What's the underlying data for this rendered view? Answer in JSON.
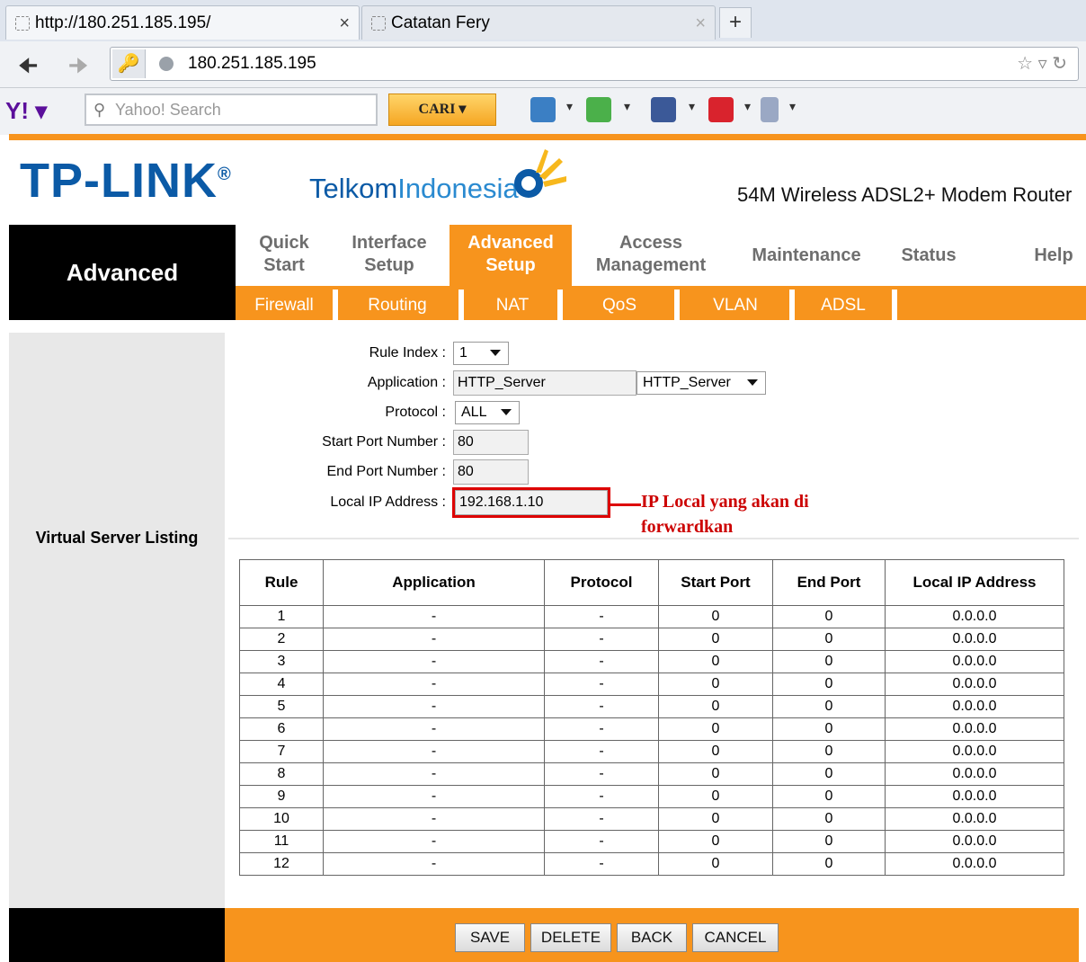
{
  "browser": {
    "tabs": [
      {
        "title": "http://180.251.185.195/",
        "close": "×"
      },
      {
        "title": "Catatan Fery",
        "close": "×"
      }
    ],
    "new_tab": "+",
    "url": "180.251.185.195",
    "toolbar": {
      "search_placeholder": "Yahoo! Search",
      "search_button": "CARI"
    }
  },
  "header": {
    "brand": "TP-LINK",
    "brand_mark": "®",
    "partner_a": "Telkom",
    "partner_b": "Indonesia",
    "model": "54M Wireless ADSL2+ Modem Router"
  },
  "nav": {
    "section": "Advanced",
    "tabs": [
      {
        "line1": "Quick",
        "line2": "Start"
      },
      {
        "line1": "Interface",
        "line2": "Setup"
      },
      {
        "line1": "Advanced",
        "line2": "Setup"
      },
      {
        "line1": "Access",
        "line2": "Management"
      },
      {
        "line1": "Maintenance"
      },
      {
        "line1": "Status"
      },
      {
        "line1": "Help"
      }
    ],
    "subtabs": [
      "Firewall",
      "Routing",
      "NAT",
      "QoS",
      "VLAN",
      "ADSL"
    ]
  },
  "form": {
    "rule_index_label": "Rule Index :",
    "rule_index_value": "1",
    "application_label": "Application :",
    "application_value": "HTTP_Server",
    "application_select": "HTTP_Server",
    "protocol_label": "Protocol :",
    "protocol_value": "ALL",
    "start_port_label": "Start Port Number :",
    "start_port_value": "80",
    "end_port_label": "End Port Number :",
    "end_port_value": "80",
    "local_ip_label": "Local IP Address :",
    "local_ip_value": "192.168.1.10"
  },
  "annotation": {
    "line1": "IP Local yang akan di",
    "line2": "forwardkan",
    "color": "#cc0000"
  },
  "listing": {
    "label": "Virtual Server Listing",
    "headers": [
      "Rule",
      "Application",
      "Protocol",
      "Start Port",
      "End Port",
      "Local IP Address"
    ],
    "rows": [
      [
        "1",
        "-",
        "-",
        "0",
        "0",
        "0.0.0.0"
      ],
      [
        "2",
        "-",
        "-",
        "0",
        "0",
        "0.0.0.0"
      ],
      [
        "3",
        "-",
        "-",
        "0",
        "0",
        "0.0.0.0"
      ],
      [
        "4",
        "-",
        "-",
        "0",
        "0",
        "0.0.0.0"
      ],
      [
        "5",
        "-",
        "-",
        "0",
        "0",
        "0.0.0.0"
      ],
      [
        "6",
        "-",
        "-",
        "0",
        "0",
        "0.0.0.0"
      ],
      [
        "7",
        "-",
        "-",
        "0",
        "0",
        "0.0.0.0"
      ],
      [
        "8",
        "-",
        "-",
        "0",
        "0",
        "0.0.0.0"
      ],
      [
        "9",
        "-",
        "-",
        "0",
        "0",
        "0.0.0.0"
      ],
      [
        "10",
        "-",
        "-",
        "0",
        "0",
        "0.0.0.0"
      ],
      [
        "11",
        "-",
        "-",
        "0",
        "0",
        "0.0.0.0"
      ],
      [
        "12",
        "-",
        "-",
        "0",
        "0",
        "0.0.0.0"
      ]
    ]
  },
  "buttons": {
    "save": "SAVE",
    "delete": "DELETE",
    "back": "BACK",
    "cancel": "CANCEL"
  },
  "colors": {
    "accent": "#f7941d",
    "brand": "#0b5aa6"
  }
}
